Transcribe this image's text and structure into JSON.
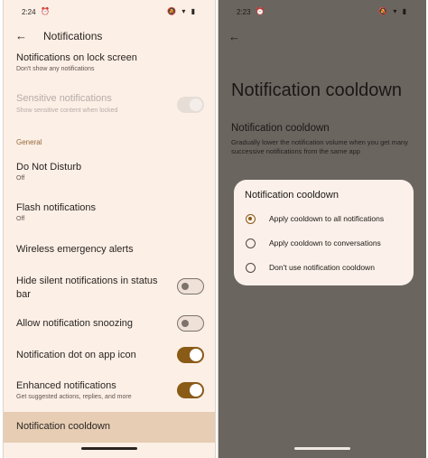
{
  "left": {
    "status_time": "2:24",
    "status_icons": "🔕 ▾ ▮",
    "title": "Notifications",
    "items": [
      {
        "title": "Notifications on lock screen",
        "subtitle": "Don't show any notifications"
      },
      {
        "title": "Sensitive notifications",
        "subtitle": "Show sensitive content when locked",
        "disabled": true,
        "switch": "on"
      },
      {
        "title": "Do Not Disturb",
        "subtitle": "Off"
      },
      {
        "title": "Flash notifications",
        "subtitle": "Off"
      },
      {
        "title": "Wireless emergency alerts"
      },
      {
        "title": "Hide silent notifications in status bar",
        "switch": "off"
      },
      {
        "title": "Allow notification snoozing",
        "switch": "off"
      },
      {
        "title": "Notification dot on app icon",
        "switch": "on"
      },
      {
        "title": "Enhanced notifications",
        "subtitle": "Get suggested actions, replies, and more",
        "switch": "on"
      },
      {
        "title": "Notification cooldown"
      }
    ],
    "section_general": "General"
  },
  "right": {
    "status_time": "2:23",
    "status_icons": "🔕 ▾ ▮",
    "page_title": "Notification cooldown",
    "pref_title": "Notification cooldown",
    "pref_subtitle": "Gradually lower the notification volume when you get many successive notifications from the same app",
    "dialog": {
      "title": "Notification cooldown",
      "options": [
        {
          "label": "Apply cooldown to all notifications",
          "selected": true
        },
        {
          "label": "Apply cooldown to conversations",
          "selected": false
        },
        {
          "label": "Don't use notification cooldown",
          "selected": false
        }
      ]
    }
  },
  "colors": {
    "accent": "#8a5a17",
    "left_bg": "#fcefe6",
    "highlight": "#e6cdb3",
    "scrim": "#6b6560"
  }
}
